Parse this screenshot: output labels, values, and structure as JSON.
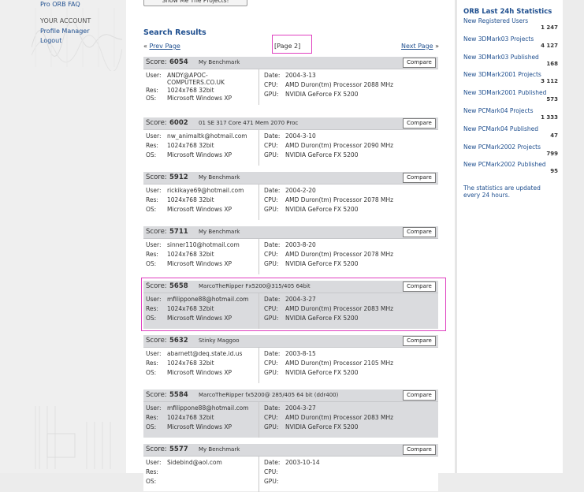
{
  "left_nav": {
    "pro_faq": "Pro ORB FAQ",
    "your_account": "YOUR ACCOUNT",
    "profile_manager": "Profile Manager",
    "logout": "Logout"
  },
  "main": {
    "top_button": "Show Me The Projects!",
    "search_results_title": "Search Results",
    "pager": {
      "prev_arrow": "«",
      "prev": "Prev Page",
      "page": "[Page 2]",
      "next": "Next Page",
      "next_arrow": "»"
    },
    "compare_label": "Compare",
    "labels": {
      "score": "Score:",
      "user": "User:",
      "res": "Res:",
      "os": "OS:",
      "date": "Date:",
      "cpu": "CPU:",
      "gpu": "GPU:"
    },
    "results": [
      {
        "score": "6054",
        "name": "My Benchmark",
        "user": "ANDY@APOC-",
        "user2": "COMPUTERS.CO.UK",
        "res": "1024x768 32bit",
        "os": "Microsoft Windows XP",
        "date": "2004-3-13",
        "cpu": "AMD Duron(tm) Processor 2088 MHz",
        "gpu": "NVIDIA GeForce FX 5200"
      },
      {
        "score": "6002",
        "name": "01 SE 317 Core 471 Mem 2070 Proc",
        "user": "nw_animaltk@hotmail.com",
        "user2": "",
        "res": "1024x768 32bit",
        "os": "Microsoft Windows XP",
        "date": "2004-3-10",
        "cpu": "AMD Duron(tm) Processor 2090 MHz",
        "gpu": "NVIDIA GeForce FX 5200"
      },
      {
        "score": "5912",
        "name": "My Benchmark",
        "user": "rickikaye69@hotmail.com",
        "user2": "",
        "res": "1024x768 32bit",
        "os": "Microsoft Windows XP",
        "date": "2004-2-20",
        "cpu": "AMD Duron(tm) Processor 2078 MHz",
        "gpu": "NVIDIA GeForce FX 5200"
      },
      {
        "score": "5711",
        "name": "My Benchmark",
        "user": "sinner110@hotmail.com",
        "user2": "",
        "res": "1024x768 32bit",
        "os": "Microsoft Windows XP",
        "date": "2003-8-20",
        "cpu": "AMD Duron(tm) Processor 2078 MHz",
        "gpu": "NVIDIA GeForce FX 5200"
      },
      {
        "score": "5658",
        "name": "MarcoTheRipper Fx5200@315/405 64bit",
        "user": "mfilippone88@hotmail.com",
        "user2": "",
        "res": "1024x768 32bit",
        "os": "Microsoft Windows XP",
        "date": "2004-3-27",
        "cpu": "AMD Duron(tm) Processor 2083 MHz",
        "gpu": "NVIDIA GeForce FX 5200"
      },
      {
        "score": "5632",
        "name": "Stinky Maggoo",
        "user": "abarnett@deq.state.id.us",
        "user2": "",
        "res": "1024x768 32bit",
        "os": "Microsoft Windows XP",
        "date": "2003-8-15",
        "cpu": "AMD Duron(tm) Processor 2105 MHz",
        "gpu": "NVIDIA GeForce FX 5200"
      },
      {
        "score": "5584",
        "name": "MarcoTheRipper fx5200@ 285/405 64 bit (ddr400)",
        "user": "mfilippone88@hotmail.com",
        "user2": "",
        "res": "1024x768 32bit",
        "os": "Microsoft Windows XP",
        "date": "2004-3-27",
        "cpu": "AMD Duron(tm) Processor 2083 MHz",
        "gpu": "NVIDIA GeForce FX 5200"
      },
      {
        "score": "5577",
        "name": "My Benchmark",
        "user": "Sidebind@aol.com",
        "user2": "",
        "res": "",
        "os": "",
        "date": "2003-10-14",
        "cpu": "",
        "gpu": ""
      }
    ]
  },
  "right": {
    "title": "ORB Last 24h Statistics",
    "stats": [
      {
        "label": "New Registered Users",
        "value": "1 247"
      },
      {
        "label": "New 3DMark03 Projects",
        "value": "4 127"
      },
      {
        "label": "New 3DMark03 Published",
        "value": "168"
      },
      {
        "label": "New 3DMark2001 Projects",
        "value": "3 112"
      },
      {
        "label": "New 3DMark2001 Published",
        "value": "573"
      },
      {
        "label": "New PCMark04 Projects",
        "value": "1 333"
      },
      {
        "label": "New PCMark04 Published",
        "value": "47"
      },
      {
        "label": "New PCMark2002 Projects",
        "value": "799"
      },
      {
        "label": "New PCMark2002 Published",
        "value": "95"
      }
    ],
    "note": "The statistics are updated every 24 hours."
  }
}
